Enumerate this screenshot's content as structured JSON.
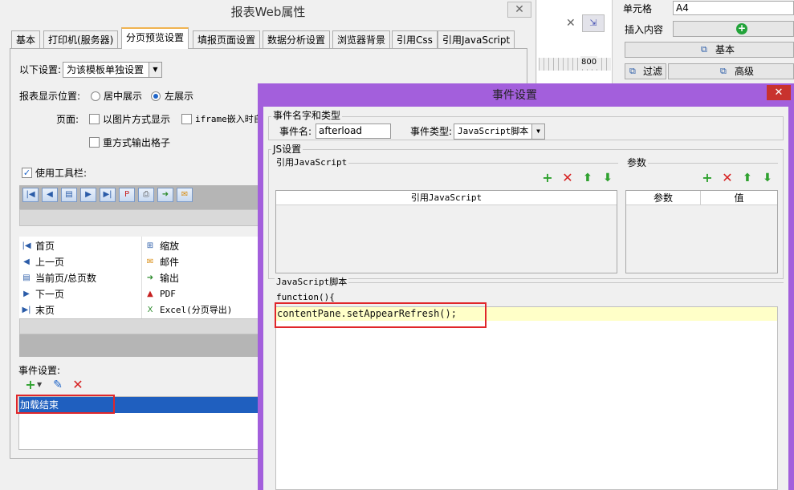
{
  "back_dialog": {
    "title": "报表Web属性",
    "close_glyph": "✕",
    "tabs": [
      "基本",
      "打印机(服务器)",
      "分页预览设置",
      "填报页面设置",
      "数据分析设置",
      "浏览器背景",
      "引用Css",
      "引用JavaScript"
    ],
    "active_tab": "分页预览设置",
    "settings_label": "以下设置:",
    "settings_value": "为该模板单独设置",
    "position_label": "报表显示位置:",
    "position_options": [
      "居中展示",
      "左展示"
    ],
    "position_selected": "左展示",
    "page_label": "页面:",
    "page_opt_image": "以图片方式显示",
    "page_opt_iframe": "iframe嵌入时自",
    "page_opt_grid": "重方式输出格子",
    "toolbar_label": "使用工具栏:",
    "toolbar_checked": true,
    "buttons_left": [
      "首页",
      "上一页",
      "当前页/总页数",
      "下一页",
      "末页"
    ],
    "buttons_right": [
      "缩放",
      "邮件",
      "输出",
      "PDF",
      "Excel(分页导出)"
    ],
    "event_label": "事件设置:",
    "event_item": "加载结束"
  },
  "right_strip": {
    "cell_label": "单元格",
    "cell_value": "A4",
    "insert_label": "插入内容",
    "basic_button": "基本",
    "filter_button": "过滤",
    "advanced_button": "高级",
    "ruler_mark": "800"
  },
  "front_dialog": {
    "title": "事件设置",
    "close_glyph": "✕",
    "name_type_group": "事件名字和类型",
    "event_name_label": "事件名:",
    "event_name_value": "afterload",
    "event_type_label": "事件类型:",
    "event_type_value": "JavaScript脚本",
    "js_group": "JS设置",
    "ref_js_group": "引用JavaScript",
    "ref_js_header": "引用JavaScript",
    "params_group": "参数",
    "params_headers": [
      "参数",
      "值"
    ],
    "script_group": "JavaScript脚本",
    "code_line1": "function(){",
    "code_line2": "contentPane.setAppearRefresh();"
  },
  "colors": {
    "accent_purple": "#a35fdc",
    "selection_blue": "#1f5fbf",
    "highlight_red": "#e0262a",
    "code_highlight": "#ffffc8"
  }
}
